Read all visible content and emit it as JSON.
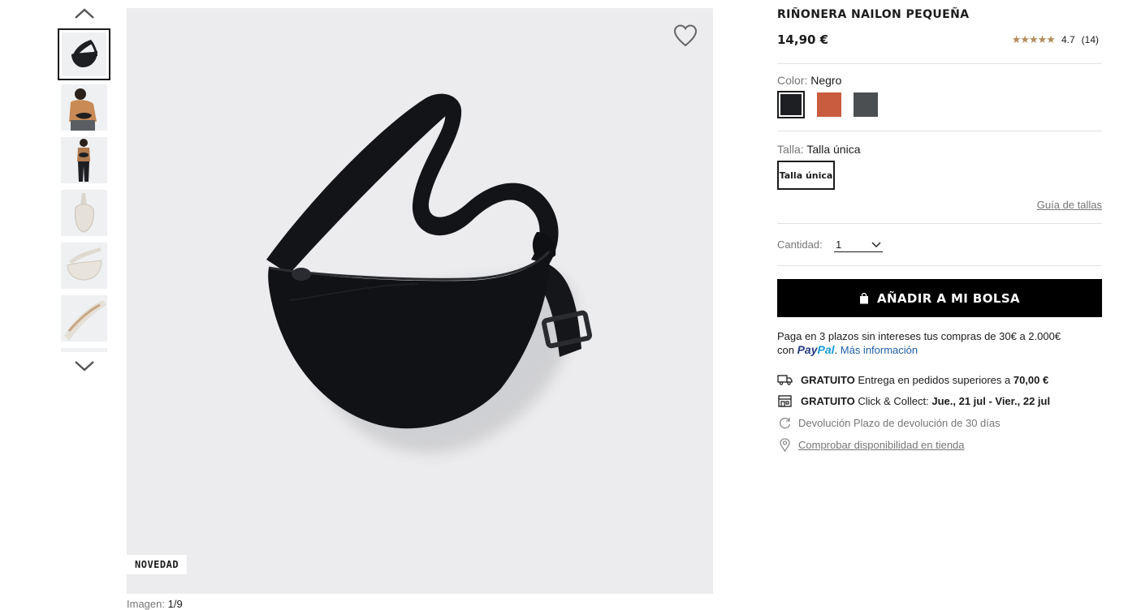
{
  "gallery": {
    "thumbnails": [
      {
        "id": "thumb-1",
        "selected": true,
        "subject": "black bag"
      },
      {
        "id": "thumb-2",
        "subject": "model wearing bag"
      },
      {
        "id": "thumb-3",
        "subject": "model full body"
      },
      {
        "id": "thumb-4",
        "subject": "white bag hanging"
      },
      {
        "id": "thumb-5",
        "subject": "white bag"
      },
      {
        "id": "thumb-6",
        "subject": "bag zipper detail"
      }
    ],
    "badge": "NOVEDAD",
    "counter_label": "Imagen:",
    "counter_value": "1/9"
  },
  "product": {
    "title": "RIÑONERA NAILON PEQUEÑA",
    "price": "14,90 €",
    "rating_stars": "★★★★★",
    "rating_value": "4.7",
    "rating_count": "(14)"
  },
  "color": {
    "label": "Color:",
    "value": "Negro",
    "swatches": [
      {
        "name": "Negro",
        "hex": "#1e1f22",
        "selected": true
      },
      {
        "name": "Naranja",
        "hex": "#c95b3e"
      },
      {
        "name": "Gris",
        "hex": "#4b4f52"
      }
    ]
  },
  "size": {
    "label": "Talla:",
    "value": "Talla única",
    "option": "Talla única",
    "guide": "Guía de tallas"
  },
  "quantity": {
    "label": "Cantidad:",
    "value": "1"
  },
  "cart": {
    "add_label": "AÑADIR A MI BOLSA"
  },
  "paypal": {
    "text": "Paga en 3 plazos sin intereses tus compras de 30€ a 2.000€",
    "con": "con",
    "logo_part1": "Pay",
    "logo_part2": "Pal",
    "more": "Más información"
  },
  "delivery": {
    "shipping_bold": "GRATUITO",
    "shipping_text": "Entrega en pedidos superiores a",
    "shipping_amount": "70,00 €",
    "collect_bold": "GRATUITO",
    "collect_text": "Click & Collect:",
    "collect_dates": "Jue., 21 jul - Vier., 22 jul",
    "return_text": "Devolución Plazo de devolución de 30 días",
    "store_text": "Comprobar disponibilidad en tienda"
  },
  "colors": {
    "image_bg": "#ececee",
    "thumb_bg": "#eef0f2",
    "accent_black": "#000000",
    "star": "#b38b5a",
    "link_blue": "#1f5fa8"
  }
}
